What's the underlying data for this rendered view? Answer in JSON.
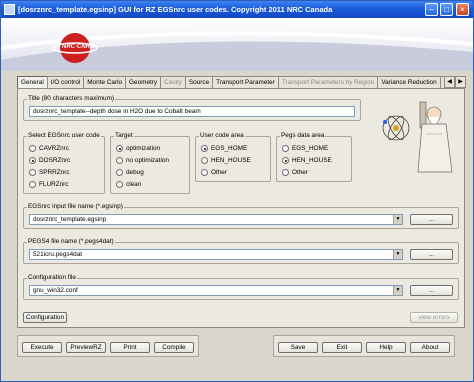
{
  "window": {
    "title": "[dosrznrc_template.egsinp] GUI for RZ EGSnrc user codes. Copyright 2011 NRC Canada",
    "title_color": "#1a5bd8"
  },
  "banner": {
    "logo_text": "NRC·CNRC",
    "logo_color": "#cc1f1f"
  },
  "tabs": [
    {
      "label": "General",
      "active": true
    },
    {
      "label": "I/O control"
    },
    {
      "label": "Monte Carlo"
    },
    {
      "label": "Geometry"
    },
    {
      "label": "Cavity",
      "disabled": true
    },
    {
      "label": "Source"
    },
    {
      "label": "Transport Parameter"
    },
    {
      "label": "Transport Parameters by Region",
      "disabled": true
    },
    {
      "label": "Variance Reduction"
    },
    {
      "label": "Plot"
    }
  ],
  "title_group": {
    "label": "Title (80 characters maximum)",
    "value": "dosrznrc_template--depth dose in H2O due to Cobalt beam"
  },
  "usercode_group": {
    "label": "Select EGSnrc user code",
    "options": [
      "CAVRZnrc",
      "DOSRZnrc",
      "SPRRZnrc",
      "FLURZnrc"
    ],
    "selected": "DOSRZnrc"
  },
  "target_group": {
    "label": "Target",
    "options": [
      "optimization",
      "no optimization",
      "debug",
      "clean"
    ],
    "selected": "optimization"
  },
  "usercode_area": {
    "label": "User code area",
    "options": [
      "EGS_HOME",
      "HEN_HOUSE",
      "Other"
    ],
    "selected": "EGS_HOME"
  },
  "pegs_area": {
    "label": "Pegs data area",
    "options": [
      "EGS_HOME",
      "HEN_HOUSE",
      "Other"
    ],
    "selected": "HEN_HOUSE"
  },
  "input_file": {
    "label": "EGSnrc input file name (*.egsinp)",
    "value": "dosrznrc_template.egsinp",
    "browse_label": "..."
  },
  "pegs_file": {
    "label": "PEGS4 file name (*.pegs4dat)",
    "value": "521icru.pegs4dat",
    "browse_label": "..."
  },
  "config_file": {
    "label": "Configuration file",
    "value": "gnu_win32.conf",
    "browse_label": "..."
  },
  "config_button": "Configuration",
  "view_errors_button": "view errors",
  "actions_left": [
    "Execute",
    "PreviewRZ",
    "Print",
    "Compile"
  ],
  "actions_right": [
    "Save",
    "Exit",
    "Help",
    "About"
  ]
}
